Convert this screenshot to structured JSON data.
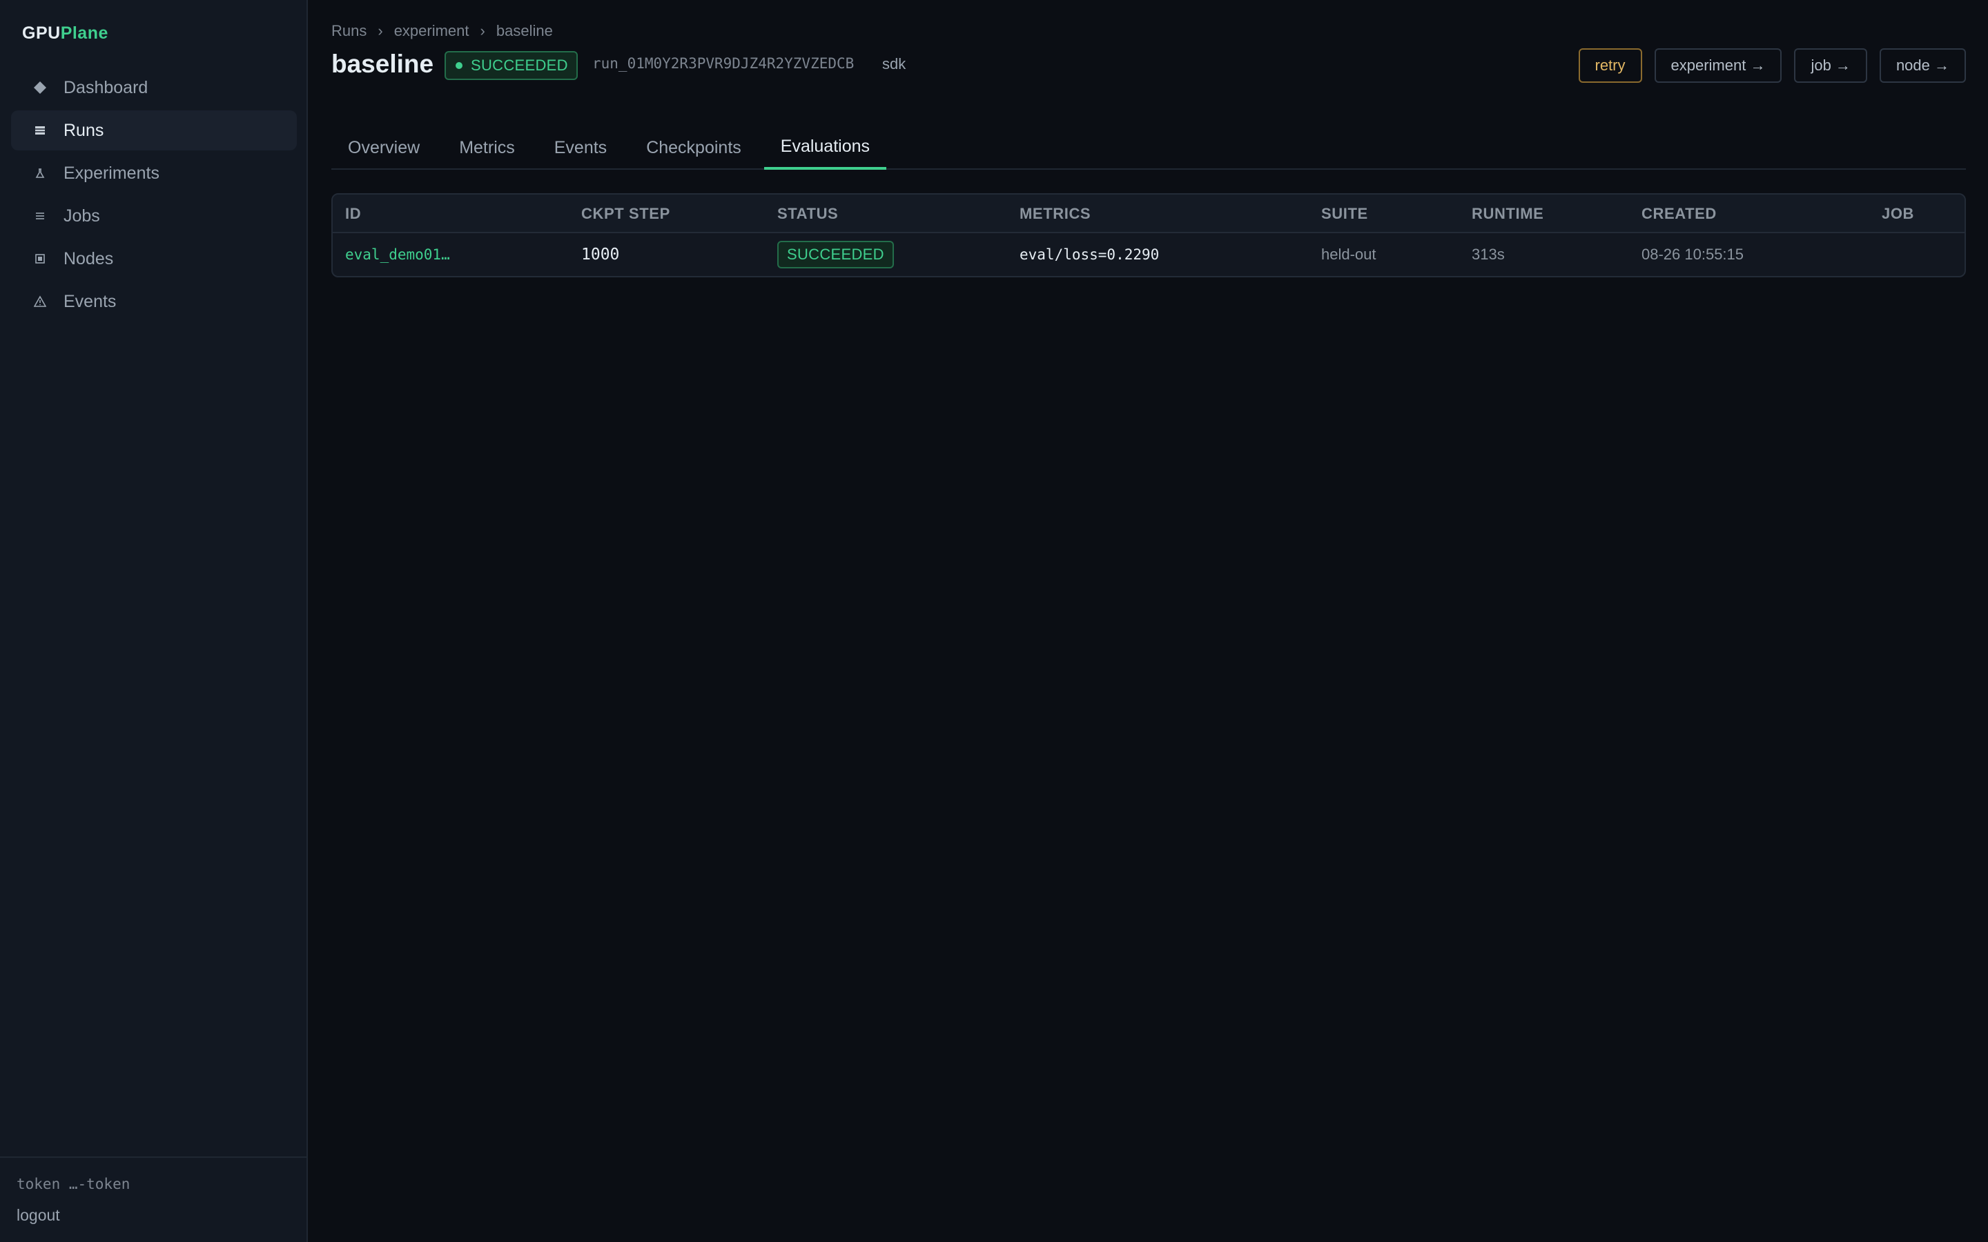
{
  "brand": {
    "part1": "GPU",
    "part2": "Plane"
  },
  "sidebar": {
    "items": [
      {
        "label": "Dashboard",
        "icon": "diamond-icon"
      },
      {
        "label": "Runs",
        "icon": "square-icon"
      },
      {
        "label": "Experiments",
        "icon": "flask-icon"
      },
      {
        "label": "Jobs",
        "icon": "list-icon"
      },
      {
        "label": "Nodes",
        "icon": "node-icon"
      },
      {
        "label": "Events",
        "icon": "warning-icon"
      }
    ],
    "active": "Runs",
    "token": "token …-token",
    "logout": "logout"
  },
  "breadcrumb": [
    "Runs",
    "experiment",
    "baseline"
  ],
  "header": {
    "title": "baseline",
    "status": "SUCCEEDED",
    "run_id": "run_01M0Y2R3PVR9DJZ4R2YZVZEDCB",
    "source": "sdk"
  },
  "actions": {
    "retry": "retry",
    "experiment": "experiment →",
    "job": "job →",
    "node": "node →"
  },
  "tabs": [
    "Overview",
    "Metrics",
    "Events",
    "Checkpoints",
    "Evaluations"
  ],
  "active_tab": "Evaluations",
  "table": {
    "columns": [
      "ID",
      "CKPT STEP",
      "STATUS",
      "METRICS",
      "SUITE",
      "RUNTIME",
      "CREATED",
      "JOB"
    ],
    "rows": [
      {
        "id": "eval_demo01…",
        "ckpt_step": "1000",
        "status": "SUCCEEDED",
        "metrics": "eval/loss=0.2290",
        "suite": "held-out",
        "runtime": "313s",
        "created": "08-26 10:55:15",
        "job": ""
      }
    ]
  },
  "colors": {
    "accent": "#3fcf8e",
    "background": "#0b0e14",
    "sidebar": "#121822",
    "retry": "#e3b865"
  }
}
